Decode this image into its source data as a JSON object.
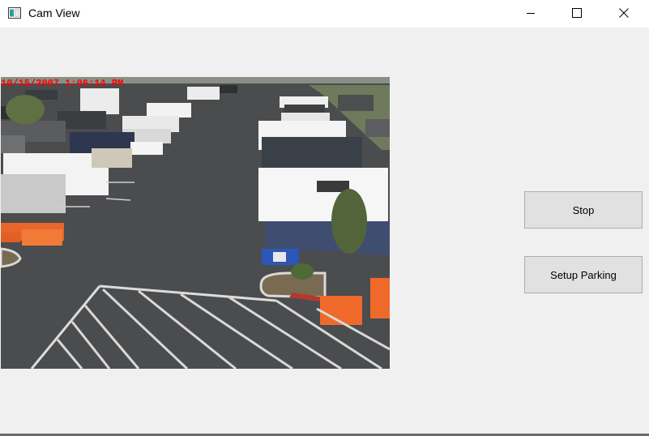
{
  "window": {
    "title": "Cam View"
  },
  "camera": {
    "timestamp": "10/15/2007 1:06:14 PM"
  },
  "controls": {
    "stop_label": "Stop",
    "setup_parking_label": "Setup Parking"
  },
  "icons": {
    "app": "app-window-icon",
    "minimize": "minimize-icon",
    "maximize": "maximize-icon",
    "close": "close-icon"
  }
}
